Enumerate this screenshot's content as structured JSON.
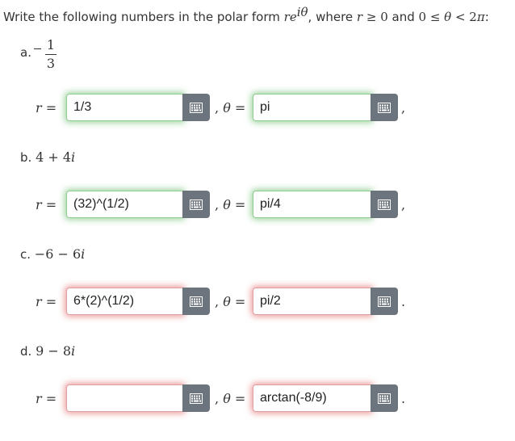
{
  "instructions": {
    "prefix": "Write the following numbers in the polar form ",
    "form_r": "r",
    "form_e": "e",
    "form_exp": "iθ",
    "mid": ", where ",
    "cond_r": "r",
    "cond_1": " ≥ 0",
    "and": " and ",
    "cond_2": "0 ≤ ",
    "cond_theta": "θ",
    "cond_3": " < 2",
    "cond_pi": "π",
    "suffix": ":"
  },
  "parts": [
    {
      "letter": "a.",
      "expr_sign": "−",
      "frac_num": "1",
      "frac_den": "3",
      "r_label": "r",
      "eq": " =",
      "r_value": "1/3",
      "r_status": "correct",
      "theta_label": "θ",
      "sep": ",",
      "theta_value": "pi",
      "theta_status": "correct",
      "end": ","
    },
    {
      "letter": "b.",
      "expr": "4 + 4",
      "expr_i": "i",
      "r_label": "r",
      "eq": " =",
      "r_value": "(32)^(1/2)",
      "r_status": "correct",
      "theta_label": "θ",
      "sep": ",",
      "theta_value": "pi/4",
      "theta_status": "correct",
      "end": ","
    },
    {
      "letter": "c.",
      "expr": "−6 − 6",
      "expr_i": "i",
      "r_label": "r",
      "eq": " =",
      "r_value": "6*(2)^(1/2)",
      "r_status": "incorrect",
      "theta_label": "θ",
      "sep": ",",
      "theta_value": "pi/2",
      "theta_status": "incorrect",
      "end": "."
    },
    {
      "letter": "d.",
      "expr": "9 − 8",
      "expr_i": "i",
      "r_label": "r",
      "eq": " =",
      "r_value": "",
      "r_status": "incorrect",
      "theta_label": "θ",
      "sep": ",",
      "theta_value": "arctan(-8/9)",
      "theta_status": "incorrect",
      "end": "."
    }
  ],
  "icons": {
    "editor_button": "keyboard-grid-icon"
  },
  "colors": {
    "correct_glow": "#4caf50",
    "incorrect_glow": "#dc3c3c",
    "button_bg": "#6c757d"
  }
}
